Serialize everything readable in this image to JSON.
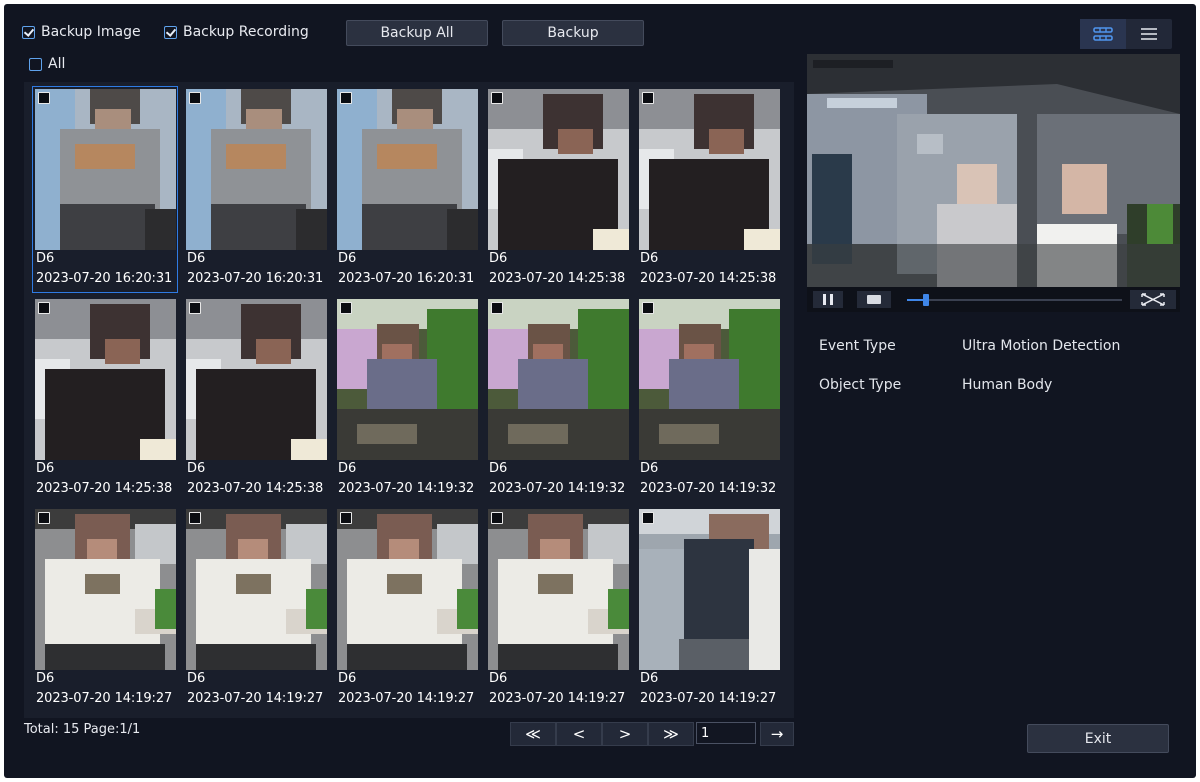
{
  "toolbar": {
    "backup_image_label": "Backup Image",
    "backup_recording_label": "Backup Recording",
    "backup_all_label": "Backup All",
    "backup_label": "Backup",
    "grid_view_icon": "grid-view-icon",
    "list_view_icon": "list-view-icon"
  },
  "select_all_label": "All",
  "items": [
    {
      "channel": "D6",
      "timestamp": "2023-07-20 16:20:31",
      "scene": 0
    },
    {
      "channel": "D6",
      "timestamp": "2023-07-20 16:20:31",
      "scene": 0
    },
    {
      "channel": "D6",
      "timestamp": "2023-07-20 16:20:31",
      "scene": 0
    },
    {
      "channel": "D6",
      "timestamp": "2023-07-20 14:25:38",
      "scene": 1
    },
    {
      "channel": "D6",
      "timestamp": "2023-07-20 14:25:38",
      "scene": 1
    },
    {
      "channel": "D6",
      "timestamp": "2023-07-20 14:25:38",
      "scene": 1
    },
    {
      "channel": "D6",
      "timestamp": "2023-07-20 14:25:38",
      "scene": 1
    },
    {
      "channel": "D6",
      "timestamp": "2023-07-20 14:19:32",
      "scene": 2
    },
    {
      "channel": "D6",
      "timestamp": "2023-07-20 14:19:32",
      "scene": 2
    },
    {
      "channel": "D6",
      "timestamp": "2023-07-20 14:19:32",
      "scene": 2
    },
    {
      "channel": "D6",
      "timestamp": "2023-07-20 14:19:27",
      "scene": 3
    },
    {
      "channel": "D6",
      "timestamp": "2023-07-20 14:19:27",
      "scene": 3
    },
    {
      "channel": "D6",
      "timestamp": "2023-07-20 14:19:27",
      "scene": 3
    },
    {
      "channel": "D6",
      "timestamp": "2023-07-20 14:19:27",
      "scene": 3
    },
    {
      "channel": "D6",
      "timestamp": "2023-07-20 14:19:27",
      "scene": 4
    }
  ],
  "footer": {
    "total_text": "Total: 15  Page:1/1",
    "first_icon": "≪",
    "prev_icon": "<",
    "next_icon": ">",
    "last_icon": "≫",
    "page_input_value": "1",
    "go_icon": "→"
  },
  "playback": {
    "pause_icon": "pause-icon",
    "stop_icon": "stop-icon",
    "fullscreen_icon": "fullscreen-icon",
    "progress": 0.09
  },
  "details": {
    "event_type_label": "Event Type",
    "event_type_value": "Ultra Motion Detection",
    "object_type_label": "Object Type",
    "object_type_value": "Human Body"
  },
  "exit_label": "Exit",
  "colors": {
    "background": "#111521",
    "panel": "#191e2b",
    "accent": "#2f7be3"
  }
}
